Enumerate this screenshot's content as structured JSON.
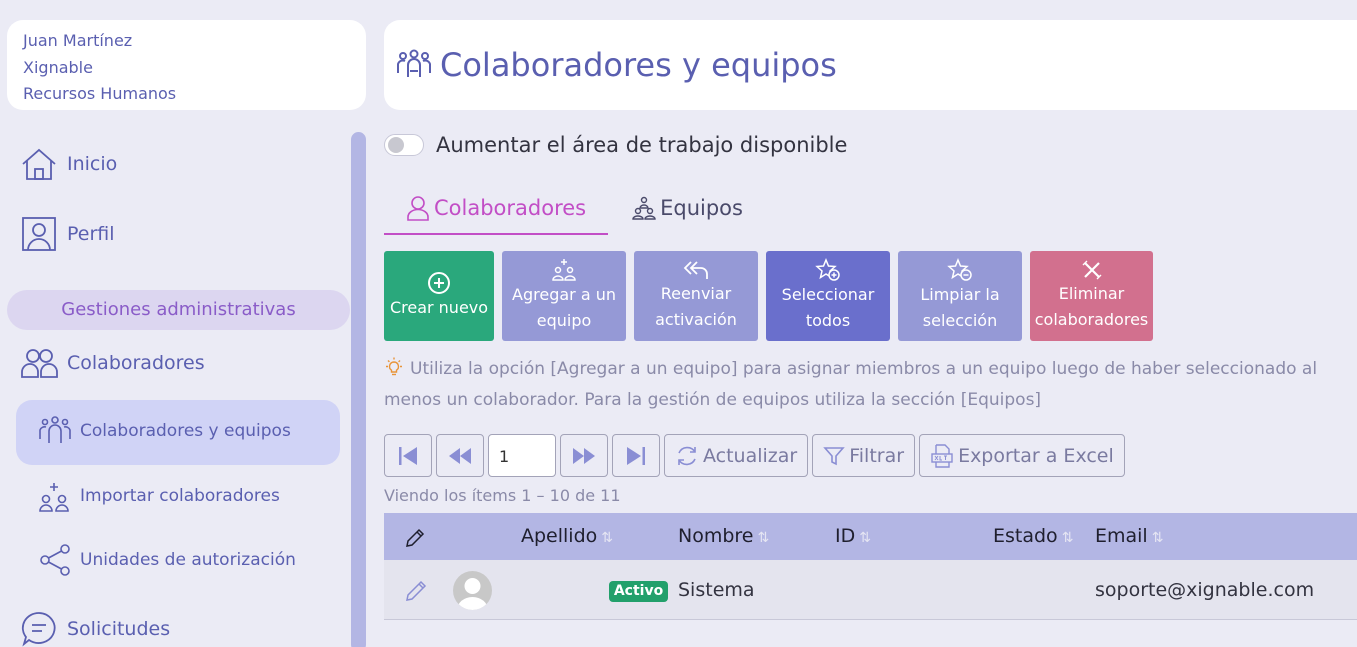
{
  "user": {
    "name": "Juan Martínez",
    "company": "Xignable",
    "department": "Recursos Humanos"
  },
  "header": {
    "title": "Colaboradores y equipos",
    "icon": "team-icon"
  },
  "sidebar": {
    "items": [
      {
        "label": "Inicio",
        "icon": "home-icon"
      },
      {
        "label": "Perfil",
        "icon": "profile-icon"
      }
    ],
    "section": "Gestiones administrativas",
    "collab_label": "Colaboradores",
    "sub_items": [
      {
        "label": "Colaboradores y equipos",
        "icon": "team-icon",
        "active": true
      },
      {
        "label": "Importar colaboradores",
        "icon": "import-users-icon"
      },
      {
        "label": "Unidades de autorización",
        "icon": "share-nodes-icon"
      }
    ],
    "requests_label": "Solicitudes"
  },
  "toggle": {
    "label": "Aumentar el área de trabajo disponible",
    "on": false
  },
  "tabs": [
    {
      "label": "Colaboradores",
      "active": true
    },
    {
      "label": "Equipos",
      "active": false
    }
  ],
  "actions": [
    {
      "label": "Crear nuevo",
      "icon": "plus-circle-icon",
      "color": "#2aa87c"
    },
    {
      "label": "Agregar a un\nequipo",
      "icon": "add-team-icon",
      "color": "#9599d6"
    },
    {
      "label": "Reenviar\nactivación",
      "icon": "reply-all-icon",
      "color": "#9599d6"
    },
    {
      "label": "Seleccionar\ntodos",
      "icon": "star-plus-icon",
      "color": "#6a6fcc"
    },
    {
      "label": "Limpiar la\nselección",
      "icon": "star-minus-icon",
      "color": "#9599d6"
    },
    {
      "label": "Eliminar\ncolaboradores",
      "icon": "close-icon",
      "color": "#d2708e"
    }
  ],
  "hint": {
    "text": "Utiliza la opción [Agregar a un equipo] para asignar miembros a un equipo luego de haber seleccionado al menos un colaborador. Para la gestión de equipos utiliza la sección [Equipos]"
  },
  "pager": {
    "page": "1",
    "refresh": "Actualizar",
    "filter": "Filtrar",
    "export": "Exportar a Excel",
    "count_text": "Viendo los ítems 1 – 10  de  11"
  },
  "table": {
    "columns": [
      "Apellido",
      "Nombre",
      "ID",
      "Estado",
      "Email"
    ],
    "rows": [
      {
        "apellido": "",
        "nombre": "Sistema",
        "id": "",
        "estado": "Activo",
        "email": "soporte@xignable.com"
      }
    ]
  }
}
